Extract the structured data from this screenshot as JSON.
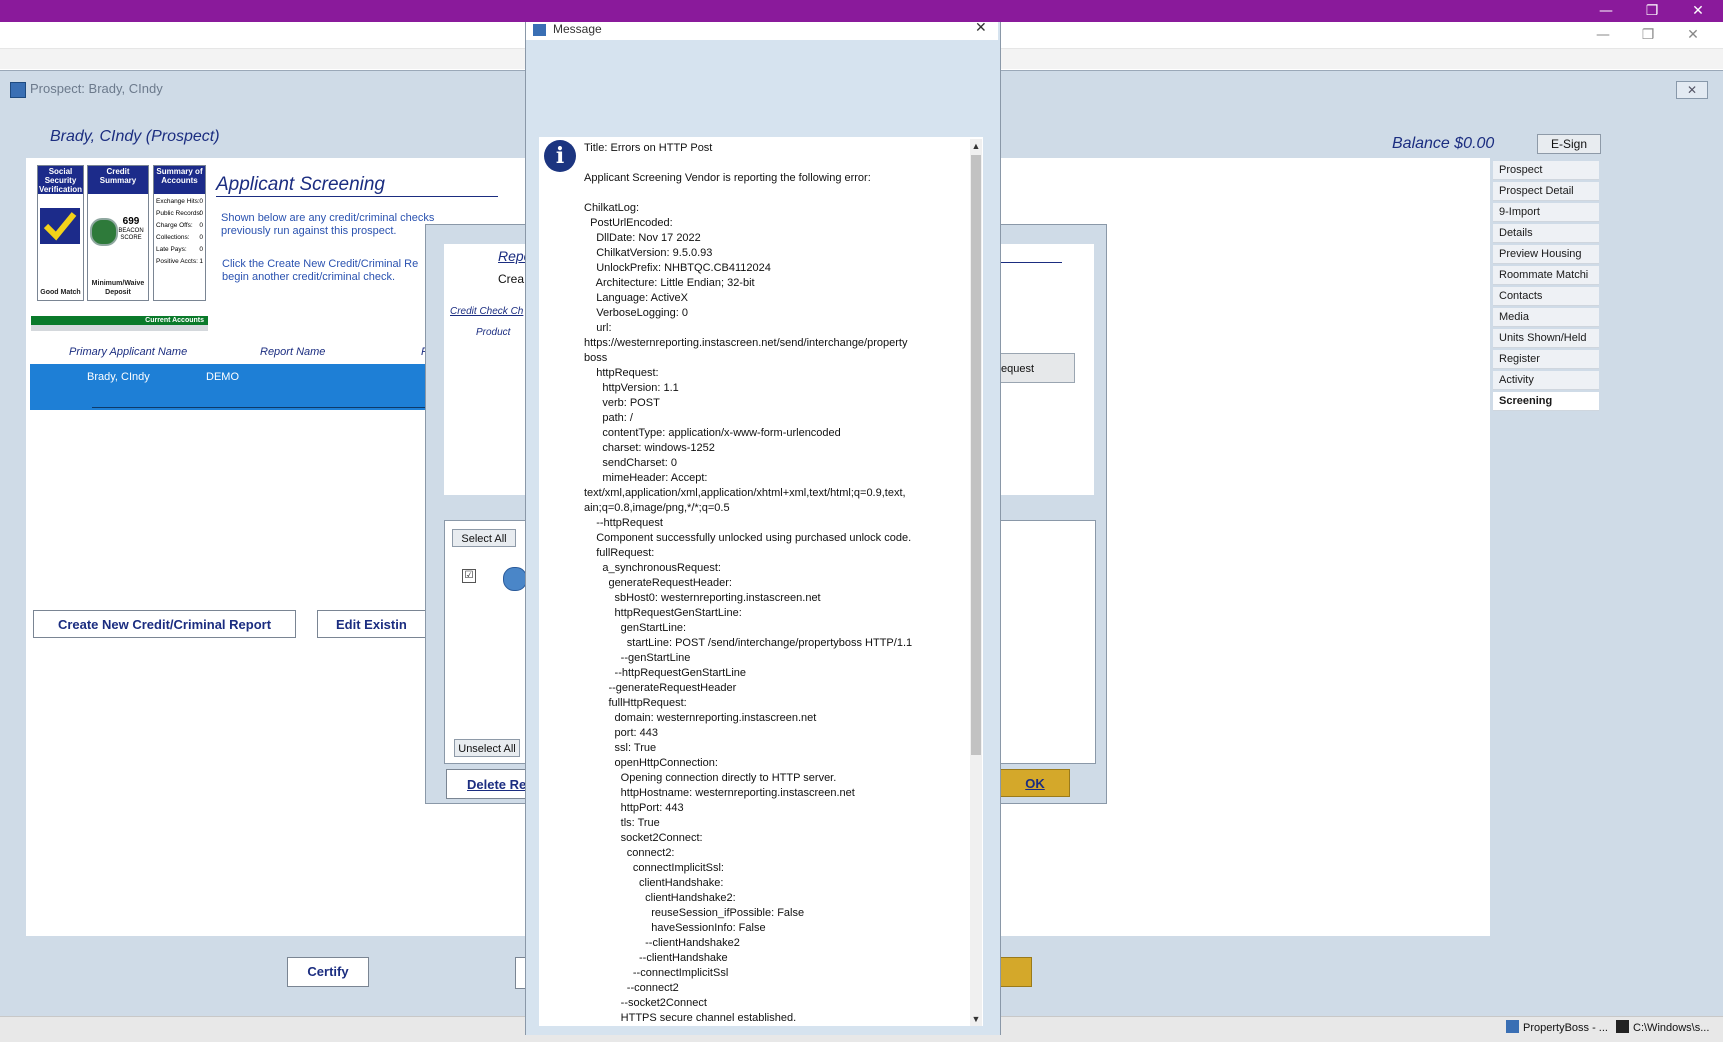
{
  "topbar": {
    "minimize": "—",
    "restore": "❐",
    "close": "✕"
  },
  "bar2": {
    "minimize": "—",
    "restore": "❐",
    "close": "✕"
  },
  "prospect_window": {
    "title": "Prospect: Brady, CIndy",
    "close": "✕",
    "prospect_name": "Brady, CIndy (Prospect)",
    "balance": "Balance $0.00",
    "esign": "E-Sign"
  },
  "nav": [
    "Prospect",
    "Prospect Detail",
    "9-Import",
    "Details",
    "Preview Housing",
    "Roommate Matchi",
    "Contacts",
    "Media",
    "Units Shown/Held",
    "Register",
    "Activity",
    "Screening"
  ],
  "cards": [
    {
      "head": "Social Security Verification",
      "foot": "Good Match"
    },
    {
      "head": "Credit Summary",
      "score": "699",
      "score_label": "BEACON SCORE",
      "foot": "Minimum/Waive Deposit"
    },
    {
      "head": "Summary of Accounts",
      "rows": [
        [
          "Exchange Hits:",
          "0"
        ],
        [
          "Public Records:",
          "0"
        ],
        [
          "Charge Offs:",
          "0"
        ],
        [
          "Collections:",
          "0"
        ],
        [
          "Late Pays:",
          "0"
        ],
        [
          "Positive Accts:",
          "1"
        ]
      ]
    }
  ],
  "screening": {
    "title": "Applicant Screening",
    "desc1": "Shown below are any credit/criminal checks previously run against this prospect.",
    "desc2": "Click the Create New Credit/Criminal Re begin another credit/criminal check.",
    "current_accounts": "Current Accounts",
    "col_primary": "Primary Applicant Name",
    "col_report": "Report Name",
    "col_extra": "R",
    "row_name": "Brady, CIndy",
    "row_report": "DEMO",
    "create_btn": "Create New Credit/Criminal Report",
    "edit_btn": "Edit Existin"
  },
  "report_dialog": {
    "title": "Repo",
    "subtitle": "Crea",
    "credit_check": "Credit Check Ch",
    "product": "Product",
    "request_btn": "equest",
    "select_all": "Select All",
    "unselect_all": "Unselect All",
    "checkbox": "☑",
    "delete_btn": "Delete Re",
    "ok_btn": "OK"
  },
  "bottom": {
    "certify": "Certify"
  },
  "taskbar": {
    "task1": "PropertyBoss - ...",
    "task2": "C:\\Windows\\s..."
  },
  "message_dialog": {
    "title": "Message",
    "close": "✕",
    "info_icon": "i",
    "scroll_up": "▲",
    "scroll_down": "▼",
    "text": "Title: Errors on HTTP Post\n\nApplicant Screening Vendor is reporting the following error:\n\nChilkatLog:\n  PostUrlEncoded:\n    DllDate: Nov 17 2022\n    ChilkatVersion: 9.5.0.93\n    UnlockPrefix: NHBTQC.CB4112024\n    Architecture: Little Endian; 32-bit\n    Language: ActiveX\n    VerboseLogging: 0\n    url:\nhttps://westernreporting.instascreen.net/send/interchange/property\nboss\n    httpRequest:\n      httpVersion: 1.1\n      verb: POST\n      path: /\n      contentType: application/x-www-form-urlencoded\n      charset: windows-1252\n      sendCharset: 0\n      mimeHeader: Accept:\ntext/xml,application/xml,application/xhtml+xml,text/html;q=0.9,text,\nain;q=0.8,image/png,*/*;q=0.5\n    --httpRequest\n    Component successfully unlocked using purchased unlock code.\n    fullRequest:\n      a_synchronousRequest:\n        generateRequestHeader:\n          sbHost0: westernreporting.instascreen.net\n          httpRequestGenStartLine:\n            genStartLine:\n              startLine: POST /send/interchange/propertyboss HTTP/1.1\n            --genStartLine\n          --httpRequestGenStartLine\n        --generateRequestHeader\n        fullHttpRequest:\n          domain: westernreporting.instascreen.net\n          port: 443\n          ssl: True\n          openHttpConnection:\n            Opening connection directly to HTTP server.\n            httpHostname: westernreporting.instascreen.net\n            httpPort: 443\n            tls: True\n            socket2Connect:\n              connect2:\n                connectImplicitSsl:\n                  clientHandshake:\n                    clientHandshake2:\n                      reuseSession_ifPossible: False\n                      haveSessionInfo: False\n                    --clientHandshake2\n                  --clientHandshake\n                --connectImplicitSsl\n              --connect2\n            --socket2Connect\n            HTTPS secure channel established."
  }
}
